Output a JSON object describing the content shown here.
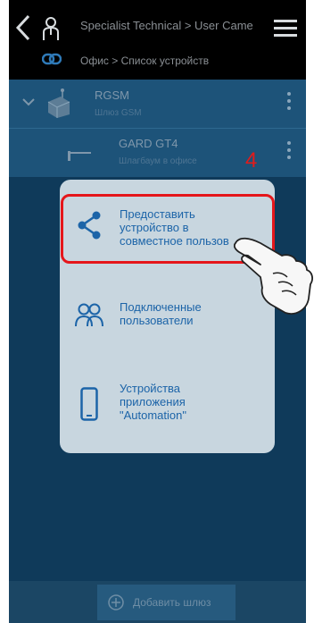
{
  "header": {
    "title": "Specialist Technical > User Came",
    "breadcrumb": "Офис > Список устройств",
    "back_icon": "chevron-left-icon",
    "user_icon": "user-icon",
    "menu_icon": "hamburger-menu-icon",
    "location_icon": "link-icon"
  },
  "devices": [
    {
      "name": "RGSM",
      "type": "Шлюз GSM",
      "icon": "gateway-icon"
    },
    {
      "name": "GARD GT4",
      "type": "Шлагбаум в офисе",
      "icon": "barrier-icon"
    }
  ],
  "annotation": {
    "step": "4"
  },
  "context_menu": {
    "items": [
      {
        "label": "Предоставить\nустройство в\nсовместное пользов",
        "icon": "share-icon",
        "highlighted": true
      },
      {
        "label": "Подключенные\nпользователи",
        "icon": "users-icon"
      },
      {
        "label": "Устройства\nприложения\n\"Automation\"",
        "icon": "smartphone-icon"
      }
    ]
  },
  "footer": {
    "add_gateway": "Добавить шлюз",
    "add_icon": "plus-circle-icon"
  },
  "colors": {
    "background": "#0f3a5a",
    "list_row": "#1d5379",
    "popup": "#c8d6df",
    "accent_text": "#1c64a8",
    "highlight": "#e5161b"
  }
}
